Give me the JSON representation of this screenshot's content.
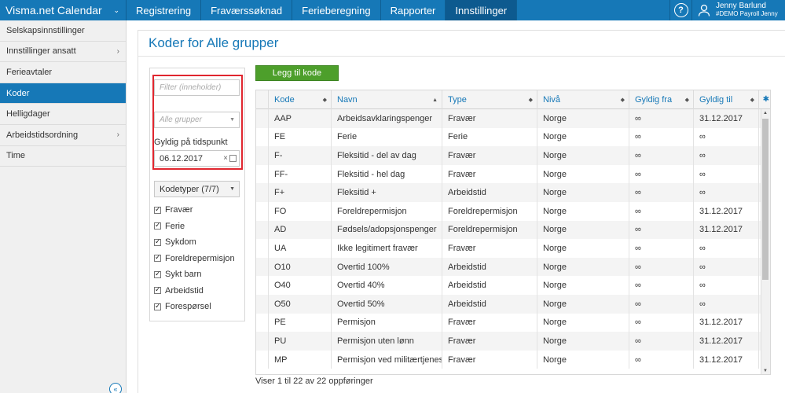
{
  "app": {
    "brand": "Visma.net Calendar"
  },
  "nav": [
    {
      "label": "Registrering"
    },
    {
      "label": "Fraværssøknad"
    },
    {
      "label": "Ferieberegning"
    },
    {
      "label": "Rapporter"
    },
    {
      "label": "Innstillinger",
      "active": true
    }
  ],
  "user": {
    "name": "Jenny Barlund",
    "company": "#DEMO Payroll Jenny"
  },
  "sidebar": {
    "items": [
      {
        "label": "Selskapsinnstillinger"
      },
      {
        "label": "Innstillinger ansatt",
        "chevron": true
      },
      {
        "label": "Ferieavtaler"
      },
      {
        "label": "Koder",
        "active": true
      },
      {
        "label": "Helligdager"
      },
      {
        "label": "Arbeidstidsordning",
        "chevron": true
      },
      {
        "label": "Time"
      }
    ]
  },
  "page": {
    "title": "Koder for Alle grupper"
  },
  "filter": {
    "filter_placeholder": "Filter (inneholder)",
    "group_placeholder": "Alle grupper",
    "valid_label": "Gyldig på tidspunkt",
    "valid_date": "06.12.2017",
    "codetypes_label": "Kodetyper (7/7)",
    "codetypes": [
      "Fravær",
      "Ferie",
      "Sykdom",
      "Foreldrepermisjon",
      "Sykt barn",
      "Arbeidstid",
      "Forespørsel"
    ]
  },
  "actions": {
    "add_label": "Legg til kode"
  },
  "table": {
    "columns": [
      "Kode",
      "Navn",
      "Type",
      "Nivå",
      "Gyldig fra",
      "Gyldig til"
    ],
    "rows": [
      [
        "AAP",
        "Arbeidsavklaringspenger",
        "Fravær",
        "Norge",
        "∞",
        "31.12.2017"
      ],
      [
        "FE",
        "Ferie",
        "Ferie",
        "Norge",
        "∞",
        "∞"
      ],
      [
        "F-",
        "Fleksitid - del av dag",
        "Fravær",
        "Norge",
        "∞",
        "∞"
      ],
      [
        "FF-",
        "Fleksitid - hel dag",
        "Fravær",
        "Norge",
        "∞",
        "∞"
      ],
      [
        "F+",
        "Fleksitid +",
        "Arbeidstid",
        "Norge",
        "∞",
        "∞"
      ],
      [
        "FO",
        "Foreldrepermisjon",
        "Foreldrepermisjon",
        "Norge",
        "∞",
        "31.12.2017"
      ],
      [
        "AD",
        "Fødsels/adopsjonspenger",
        "Foreldrepermisjon",
        "Norge",
        "∞",
        "31.12.2017"
      ],
      [
        "UA",
        "Ikke legitimert fravær",
        "Fravær",
        "Norge",
        "∞",
        "∞"
      ],
      [
        "O10",
        "Overtid 100%",
        "Arbeidstid",
        "Norge",
        "∞",
        "∞"
      ],
      [
        "O40",
        "Overtid 40%",
        "Arbeidstid",
        "Norge",
        "∞",
        "∞"
      ],
      [
        "O50",
        "Overtid 50%",
        "Arbeidstid",
        "Norge",
        "∞",
        "∞"
      ],
      [
        "PE",
        "Permisjon",
        "Fravær",
        "Norge",
        "∞",
        "31.12.2017"
      ],
      [
        "PU",
        "Permisjon uten lønn",
        "Fravær",
        "Norge",
        "∞",
        "31.12.2017"
      ],
      [
        "MP",
        "Permisjon ved militærtjeneste",
        "Fravær",
        "Norge",
        "∞",
        "31.12.2017"
      ]
    ],
    "footer": "Viser 1 til 22 av 22 oppføringer"
  },
  "icons": {
    "brand_caret": "chevron-down-icon",
    "help": "help-icon",
    "user": "user-icon",
    "settings": "gear-icon",
    "calendar": "calendar-icon",
    "collapse": "collapse-left-icon"
  }
}
